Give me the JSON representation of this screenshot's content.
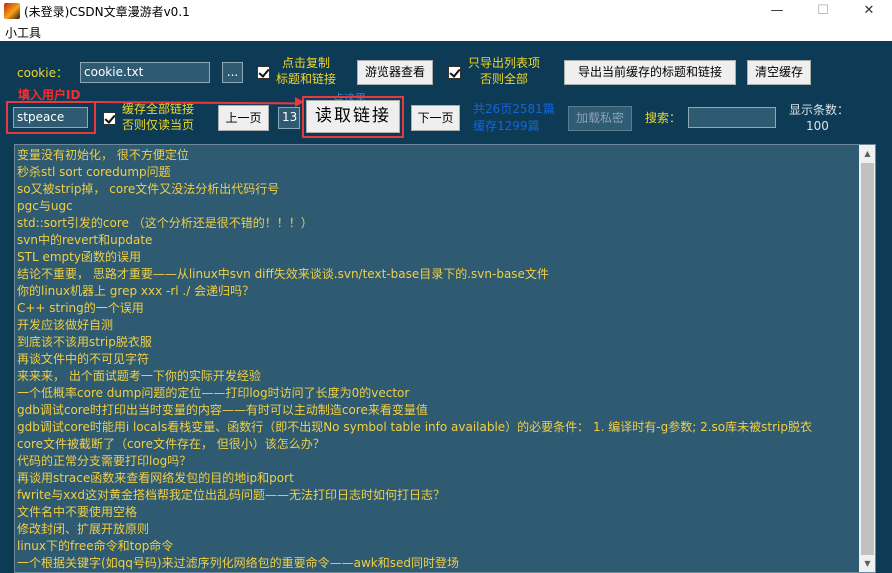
{
  "window": {
    "title": "(未登录)CSDN文章漫游者v0.1",
    "minimize": "—",
    "maximize": "☐",
    "close": "✕"
  },
  "menu": {
    "items": [
      "小工具"
    ]
  },
  "toolbar": {
    "cookie_label": "cookie：",
    "cookie_value": "cookie.txt",
    "browse_button": "...",
    "copy_checkbox_line1": "点击复制",
    "copy_checkbox_line2": "标题和链接",
    "browser_view_button": "游览器查看",
    "export_list_line1": "只导出列表项",
    "export_list_line2": "否则全部",
    "export_cache_button": "导出当前缓存的标题和链接",
    "clear_cache_button": "清空缓存",
    "fill_user_id_hint": "填入用户ID",
    "user_id_value": "stpeace",
    "cache_all_line1": "缓存全部链接",
    "cache_all_line2": "否则仅读当页",
    "prev_page_button": "上一页",
    "page_number": "13",
    "click_hint": "点这里",
    "read_links_button": "读取链接",
    "next_page_button": "下一页",
    "total_stats": "共26页2581篇",
    "cache_stats": "缓存1299篇",
    "load_private_button": "加载私密",
    "search_label": "搜索：",
    "search_value": "",
    "display_count_label": "显示条数：",
    "display_count_value": "100"
  },
  "colors": {
    "panel_bg": "#0d3b55",
    "list_bg": "#2e5a72",
    "list_text": "#f1cf45",
    "label_yellow": "#f0d72a",
    "stats_blue": "#1565d8",
    "annotation_red": "#e8393d"
  },
  "articles": [
    "变量没有初始化， 很不方便定位",
    "秒杀stl sort coredump问题",
    "so又被strip掉， core文件又没法分析出代码行号",
    "pgc与ugc",
    "std::sort引发的core （这个分析还是很不错的！！！）",
    "svn中的revert和update",
    "STL empty函数的误用",
    "结论不重要， 思路才重要——从linux中svn diff失效来谈谈.svn/text-base目录下的.svn-base文件",
    "你的linux机器上 grep xxx  -rl  ./  会递归吗？",
    "C++ string的一个误用",
    "开发应该做好自测",
    "到底该不该用strip脱衣服",
    "再谈文件中的不可见字符",
    "来来来， 出个面试题考一下你的实际开发经验",
    "一个低概率core dump问题的定位——打印log时访问了长度为0的vector",
    "gdb调试core时打印出当时变量的内容——有时可以主动制造core来看变量值",
    "gdb调试core时能用i locals看栈变量、函数行（即不出现No symbol table info available）的必要条件： 1. 编译时有-g参数; 2.so库未被strip脱衣",
    "core文件被截断了（core文件存在， 但很小）该怎么办？",
    "代码的正常分支需要打印log吗？",
    "再谈用strace函数来查看网络发包的目的地ip和port",
    "fwrite与xxd这对黄金搭档帮我定位出乱码问题——无法打印日志时如何打日志？",
    "文件名中不要使用空格",
    "修改封闭、扩展开放原则",
    "linux下的free命令和top命令",
    "一个根据关键字(如qq号码)来过滤序列化网络包的重要命令——awk和sed同时登场"
  ]
}
